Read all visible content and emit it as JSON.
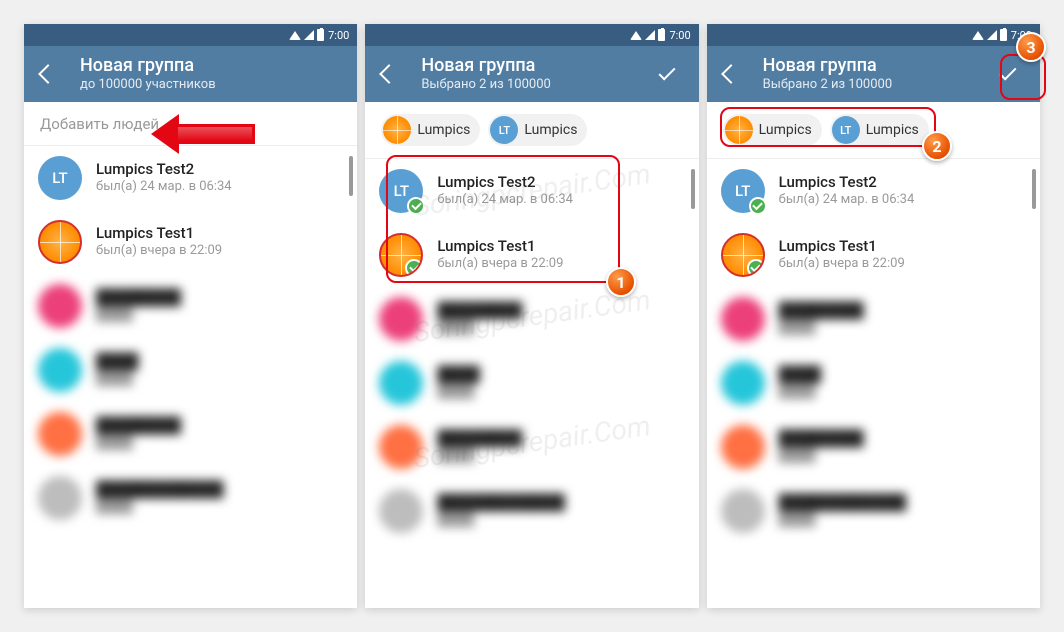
{
  "status_bar": {
    "time": "7:00"
  },
  "screens": {
    "s1": {
      "title": "Новая группа",
      "subtitle": "до 100000 участников",
      "search_placeholder": "Добавить людей..."
    },
    "s2": {
      "title": "Новая группа",
      "subtitle": "Выбрано 2 из 100000",
      "chip1_label": "Lumpics",
      "chip1_initials": "",
      "chip2_label": "Lumpics",
      "chip2_initials": "LT"
    },
    "s3": {
      "title": "Новая группа",
      "subtitle": "Выбрано 2 из 100000",
      "chip1_label": "Lumpics",
      "chip1_initials": "",
      "chip2_label": "Lumpics",
      "chip2_initials": "LT"
    }
  },
  "contacts": {
    "c1": {
      "name": "Lumpics Test2",
      "status": "был(а) 24 мар. в 06:34",
      "initials": "LT"
    },
    "c2": {
      "name": "Lumpics Test1",
      "status": "был(а) вчера в 22:09"
    }
  },
  "steps": {
    "b1": "1",
    "b2": "2",
    "b3": "3"
  },
  "watermark": "Soringpcrepair.Com"
}
